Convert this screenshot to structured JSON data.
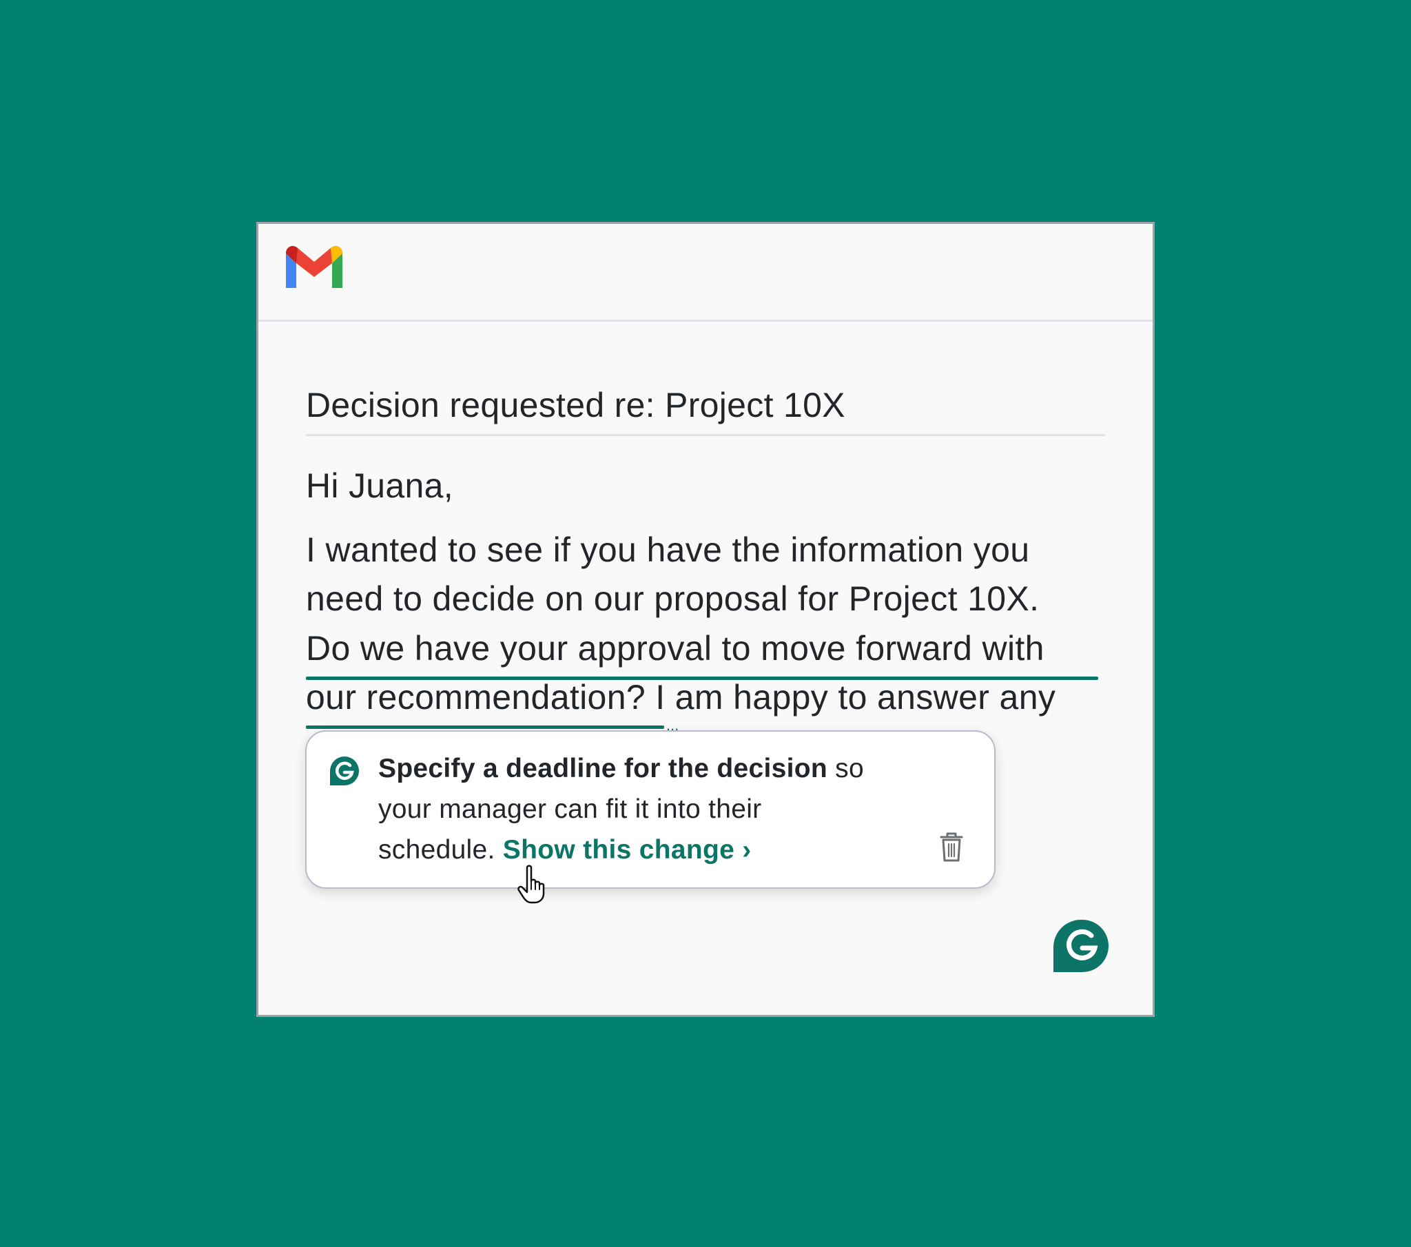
{
  "email": {
    "subject": "Decision requested re: Project 10X",
    "greeting": "Hi Juana,",
    "body_lines": [
      "I wanted to see if you have the information you",
      "need to decide on our proposal for Project 10X.",
      "Do we have your approval to move forward with",
      "our recommendation? I am happy to answer any"
    ],
    "overflow_indicator": "..."
  },
  "suggestion": {
    "bold_text": "Specify a deadline for the decision",
    "text_part1": " so",
    "text_part2": "your manager can fit it into their",
    "text_part3": "schedule. ",
    "link_text": "Show this change ›"
  },
  "icons": {
    "logo": "gmail-logo",
    "card_brand": "grammarly-icon",
    "dismiss": "trash-icon",
    "pointer": "hand-cursor-icon",
    "assistant_button": "grammarly-button-icon"
  },
  "colors": {
    "background": "#028070",
    "accent": "#0c7567",
    "text": "#222529",
    "window": "#f9f9f9"
  }
}
